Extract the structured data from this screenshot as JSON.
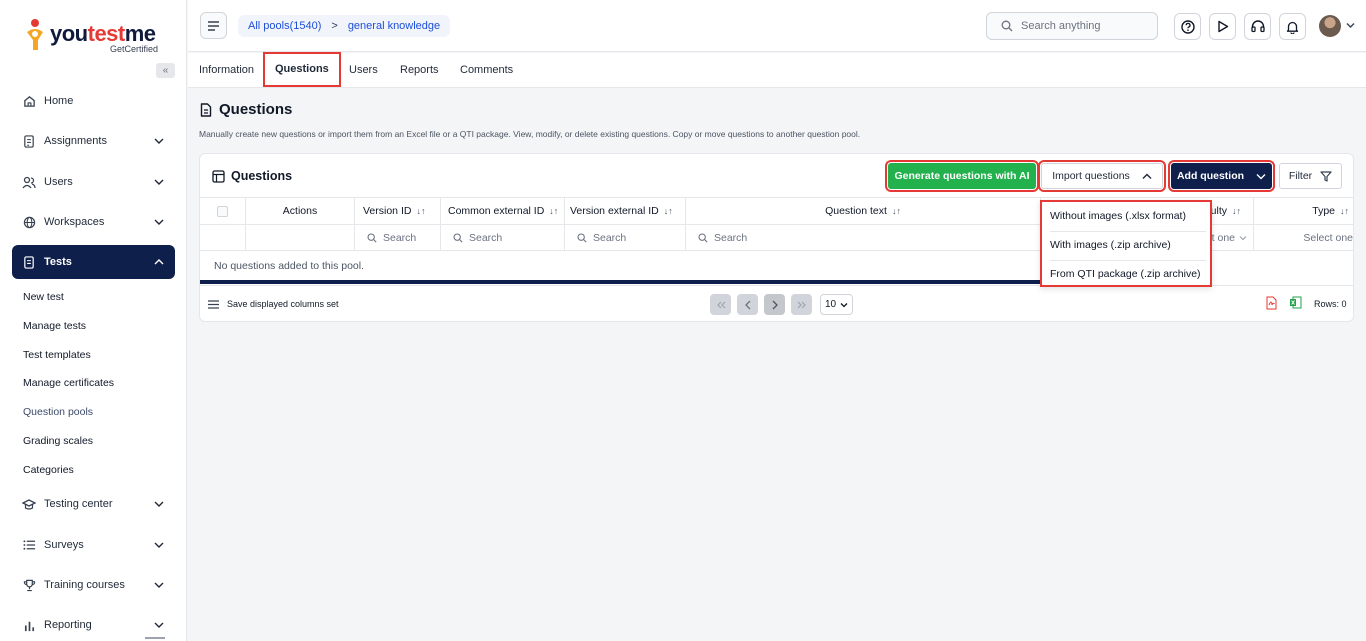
{
  "logo": {
    "brand_a": "you",
    "brand_b": "test",
    "brand_c": "me",
    "tagline": "GetCertified"
  },
  "sidebar": {
    "collapse_label": "«",
    "items": [
      {
        "label": "Home",
        "icon": "home-icon"
      },
      {
        "label": "Assignments",
        "icon": "document-icon"
      },
      {
        "label": "Users",
        "icon": "users-icon"
      },
      {
        "label": "Workspaces",
        "icon": "globe-icon"
      },
      {
        "label": "Tests",
        "icon": "test-icon"
      },
      {
        "label": "Testing center",
        "icon": "graduation-cap-icon"
      },
      {
        "label": "Surveys",
        "icon": "list-icon"
      },
      {
        "label": "Training courses",
        "icon": "trophy-icon"
      },
      {
        "label": "Reporting",
        "icon": "chart-icon"
      }
    ],
    "tests_subitems": [
      "New test",
      "Manage tests",
      "Test templates",
      "Manage certificates",
      "Question pools",
      "Grading scales",
      "Categories"
    ]
  },
  "header": {
    "breadcrumb": {
      "pools": "All pools(1540)",
      "separator": ">",
      "current": "general knowledge"
    },
    "search_placeholder": "Search anything"
  },
  "tabs": [
    "Information",
    "Questions",
    "Users",
    "Reports",
    "Comments"
  ],
  "page": {
    "title": "Questions",
    "description": "Manually create new questions or import them from an Excel file or a QTI package. View, modify, or delete existing questions. Copy or move questions to another question pool."
  },
  "card": {
    "title": "Questions",
    "generate_ai": "Generate questions with AI",
    "import": "Import questions",
    "add": "Add question",
    "filter": "Filter"
  },
  "table": {
    "columns": {
      "actions": "Actions",
      "version_id": "Version ID",
      "common_external_id": "Common external ID",
      "version_external_id": "Version external ID",
      "question_text": "Question text",
      "difficulty": "ulty",
      "type": "Type"
    },
    "sort_glyph": "↓↑",
    "search_placeholder": "Search",
    "select_one_partial": "t one",
    "select_one": "Select one",
    "empty": "No questions added to this pool."
  },
  "footer": {
    "save_columns": "Save displayed columns set",
    "page_size": "10",
    "rows": "Rows: 0"
  },
  "import_menu": [
    "Without images (.xlsx format)",
    "With images (.zip archive)",
    "From QTI package (.zip archive)"
  ],
  "colors": {
    "navy": "#0f1f4b",
    "green": "#22b14c",
    "highlight": "#e53935",
    "link": "#1d4ed8"
  }
}
